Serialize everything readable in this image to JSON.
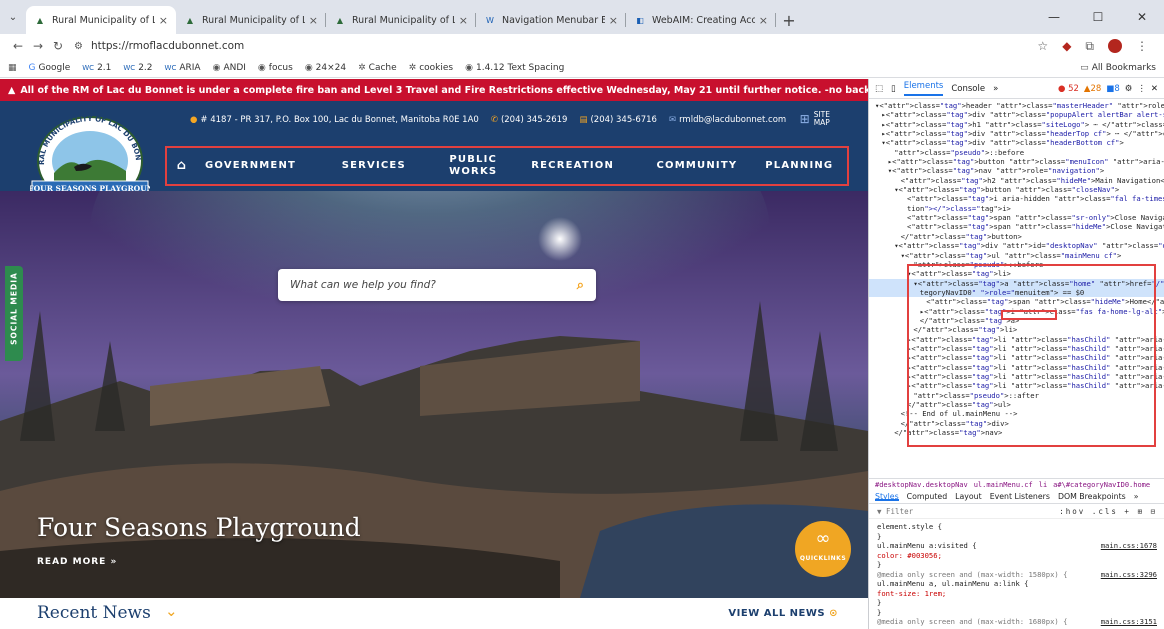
{
  "browser": {
    "tabs": [
      {
        "title": "Rural Municipality of Lac Du Bo",
        "active": true
      },
      {
        "title": "Rural Municipality of Lac Du Bo"
      },
      {
        "title": "Rural Municipality of Lac Du Bo"
      },
      {
        "title": "Navigation Menubar Example |"
      },
      {
        "title": "WebAIM: Creating Accessible F"
      }
    ],
    "url": "https://rmoflacdubonnet.com",
    "bookmarks": [
      "Google",
      "2.1",
      "2.2",
      "ARIA",
      "ANDI",
      "focus",
      "24×24",
      "Cache",
      "cookies",
      "1.4.12 Text Spacing"
    ],
    "all_bookmarks": "All Bookmarks"
  },
  "site": {
    "alert": "All of the RM of Lac du Bonnet is under a complete fire ban and Level 3 Travel and Fire Restrictions effective Wednesday, May 21 until further notice. -no back-country travel, on foot or by ...",
    "address": "# 4187 - PR 317, P.O. Box 100, Lac du Bonnet, Manitoba R0E 1A0",
    "phone": "(204) 345-2619",
    "fax": "(204) 345-6716",
    "email": "rmldb@lacdubonnet.com",
    "sitemap_line1": "SITE",
    "sitemap_line2": "MAP",
    "logo_top": "RURAL MUNICIPALITY OF LAC DU BONNET",
    "logo_banner": "A FOUR SEASONS PLAYGROUND",
    "nav": [
      {
        "label": "GOVERNMENT"
      },
      {
        "label": "SERVICES"
      },
      {
        "label": "PUBLIC WORKS"
      },
      {
        "label": "RECREATION"
      },
      {
        "label": "COMMUNITY"
      },
      {
        "label": "PLANNING"
      }
    ],
    "search_placeholder": "What can we help you find?",
    "social_media": "SOCIAL MEDIA",
    "hero_title": "Four Seasons Playground",
    "read_more": "READ MORE »",
    "quicklinks": "QUICKLINKS",
    "recent_news": "Recent News",
    "view_all": "VIEW ALL NEWS"
  },
  "devtools": {
    "tabs": [
      "Elements",
      "Console",
      "»"
    ],
    "errors": "52",
    "warnings": "28",
    "info": "8",
    "dom_lines": [
      "▾<header class=\"masterHeader\" role=\"banner\">",
      "  ▸<div class=\"popupAlert alertBar alert-severe\"> ⋯ </div>",
      "  ▸<h1 class=\"siteLogo\"> ⋯ </h1>",
      "  ▸<div class=\"headerTop cf\"> ⋯ </div>",
      "  ▾<div class=\"headerBottom cf\">",
      "      ::before",
      "    ▸<button class=\"menuIcon\" aria-label=\"Menu\"> ⋯ </button>",
      "    ▾<nav role=\"navigation\">",
      "        <h2 class=\"hideMe\">Main Navigation</h2>",
      "      ▾<button class=\"closeNav\">",
      "          <i aria-hidden class=\"fal fa-times\" title=\"Close Naviga",
      "          tion\"></i>",
      "          <span class=\"sr-only\">Close Navigation</span>",
      "          <span class=\"hideMe\">Close Navigation</span>",
      "        </button>",
      "      ▾<div id=\"desktopNav\" class=\"desktopNav\">",
      "        ▾<ul class=\"mainMenu cf\">",
      "            ::before",
      "          ▾<li>",
      "            ▾<a class=\"home\" href=\"/\" title=\"Go to home\" id=\"#ca",
      "              tegoryNavID0\" role=\"menuitem\"> == $0",
      "                <span class=\"hideMe\">Home</span>",
      "              ▸<i class=\"fas fa-home-lg-alt\"> ⋯ </i>",
      "              </a>",
      "            </li>",
      "          ▸<li class=\"hasChild\" aria-expanded=\"false\"> ⋯ </li>",
      "          ▸<li class=\"hasChild\" aria-expanded=\"false\"> ⋯ </li>",
      "          ▸<li class=\"hasChild\" aria-expanded=\"false\"> ⋯ </li>",
      "          ▸<li class=\"hasChild\" aria-expanded=\"false\"> ⋯ </li>",
      "          ▸<li class=\"hasChild\" aria-expanded=\"false\"> ⋯ </li>",
      "          ▸<li class=\"hasChild\" aria-expanded=\"false\"> ⋯ </li>",
      "            ::after",
      "          </ul>",
      "        <!-- End of ul.mainMenu -->",
      "        </div>",
      "      </nav>"
    ],
    "breadcrumbs": [
      "#desktopNav.desktopNav",
      "ul.mainMenu.cf",
      "li",
      "a#\\#categoryNavID0.home"
    ],
    "style_tabs": [
      "Styles",
      "Computed",
      "Layout",
      "Event Listeners",
      "DOM Breakpoints",
      "»"
    ],
    "filter_placeholder": "Filter",
    "filter_tools": ":hov .cls + ⊞ ⊟",
    "css_lines": [
      {
        "text": "element.style {",
        "src": ""
      },
      {
        "text": "}",
        "src": ""
      },
      {
        "text": "ul.mainMenu a:visited {",
        "src": "main.css:1678"
      },
      {
        "text": "  color: #003056;",
        "src": ""
      },
      {
        "text": "}",
        "src": ""
      },
      {
        "text": "@media only screen and (max-width: 1580px) {",
        "src": "main.css:3296"
      },
      {
        "text": "ul.mainMenu a, ul.mainMenu a:link {",
        "src": ""
      },
      {
        "text": "  font-size: 1rem;",
        "src": ""
      },
      {
        "text": "}",
        "src": ""
      },
      {
        "text": "}",
        "src": ""
      },
      {
        "text": "@media only screen and (max-width: 1680px) {",
        "src": "main.css:3151"
      }
    ]
  },
  "colors": {
    "alert_red": "#c8102e",
    "header_navy": "#1c3f6e",
    "accent_orange": "#f0a623",
    "social_green": "#2e8b4e",
    "highlight_red": "#e2403f"
  }
}
